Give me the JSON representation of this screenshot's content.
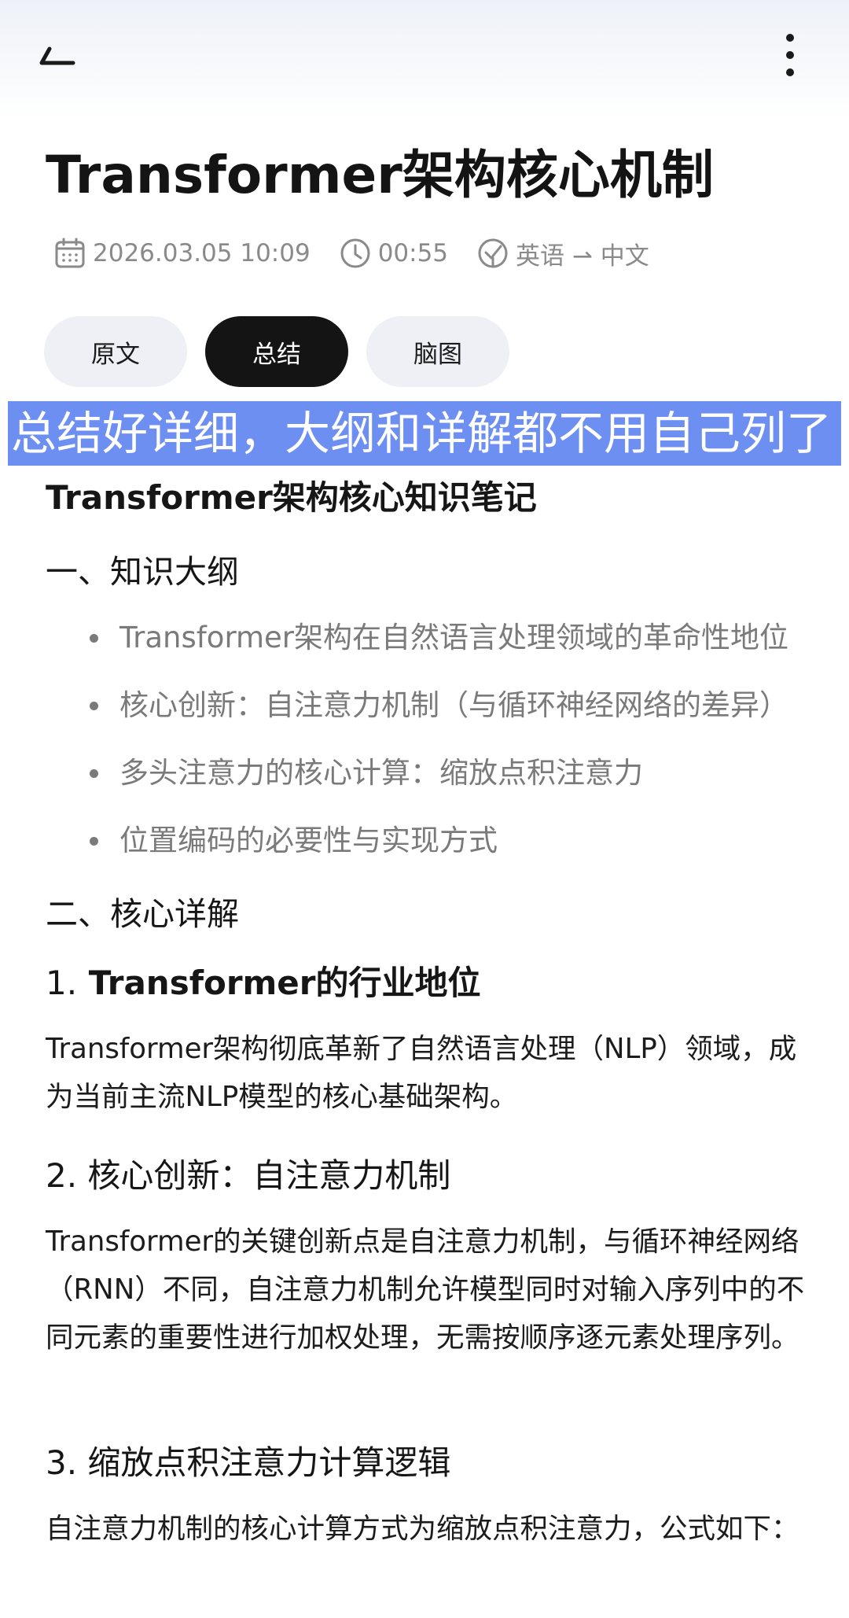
{
  "topbar": {
    "back_icon": "back-arrow-icon",
    "more_icon": "more-vertical-icon"
  },
  "title": "Transformer架构核心机制",
  "meta": {
    "datetime": "2026.03.05 10:09",
    "duration": "00:55",
    "language": "英语 ⇀ 中文"
  },
  "tabs": [
    {
      "label": "原文",
      "active": false
    },
    {
      "label": "总结",
      "active": true
    },
    {
      "label": "脑图",
      "active": false
    }
  ],
  "banner": "总结好详细，大纲和详解都不用自己列了",
  "summary": {
    "doc_title": "Transformer架构核心知识笔记",
    "outline_heading": "一、知识大纲",
    "outline_items": [
      "Transformer架构在自然语言处理领域的革命性地位",
      "核心创新：自注意力机制（与循环神经网络的差异）",
      "多头注意力的核心计算：缩放点积注意力",
      "位置编码的必要性与实现方式"
    ],
    "detail_heading": "二、核心详解",
    "sections": [
      {
        "num": "1.",
        "title": " Transformer的行业地位",
        "body": "Transformer架构彻底革新了自然语言处理（NLP）领域，成为当前主流NLP模型的核心基础架构。"
      },
      {
        "num": "2.",
        "title": " 核心创新：自注意力机制",
        "body": "Transformer的关键创新点是自注意力机制，与循环神经网络（RNN）不同，自注意力机制允许模型同时对输入序列中的不同元素的重要性进行加权处理，无需按顺序逐元素处理序列。"
      },
      {
        "num": "3.",
        "title": " 缩放点积注意力计算逻辑",
        "body": "自注意力机制的核心计算方式为缩放点积注意力，公式如下："
      }
    ]
  },
  "colors": {
    "highlight": "#6d8ff2",
    "tab_active": "#141414",
    "tab_inactive": "#eef0f5",
    "meta_text": "#8a8a8a"
  }
}
